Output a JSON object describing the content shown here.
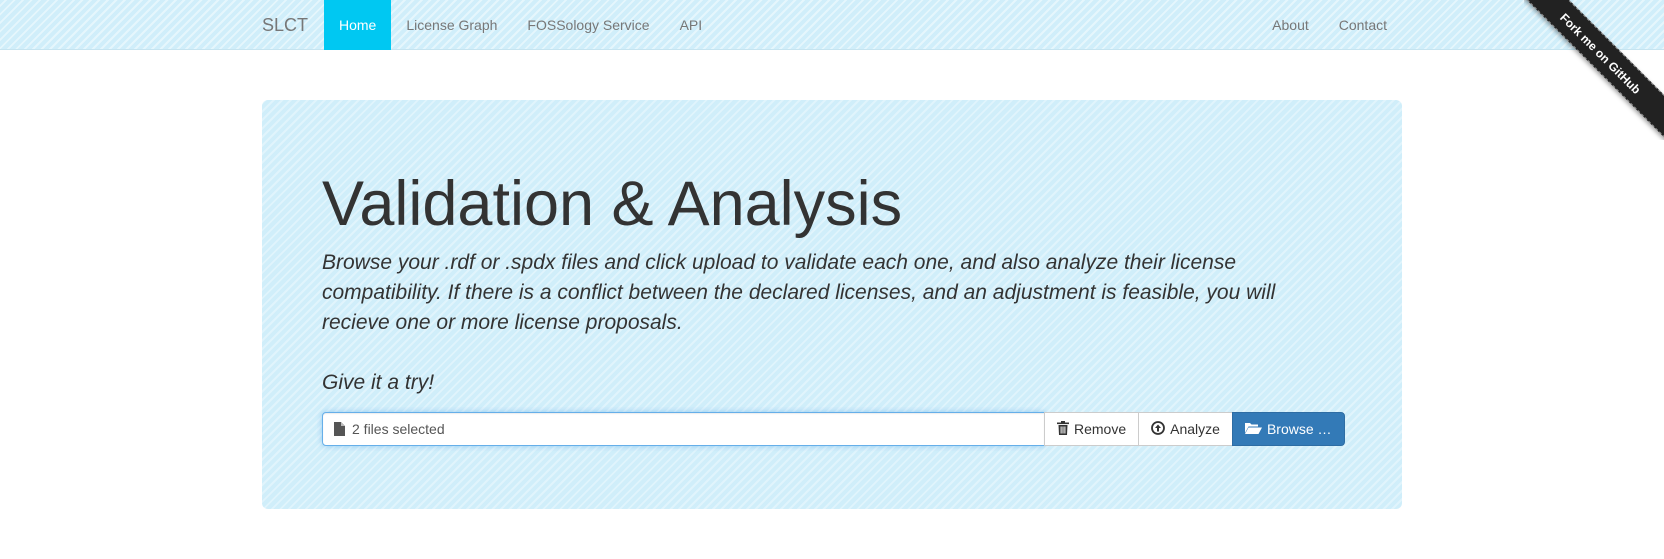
{
  "navbar": {
    "brand": "SLCT",
    "left_items": [
      {
        "label": "Home",
        "active": true
      },
      {
        "label": "License Graph",
        "active": false
      },
      {
        "label": "FOSSology Service",
        "active": false
      },
      {
        "label": "API",
        "active": false
      }
    ],
    "right_items": [
      {
        "label": "About"
      },
      {
        "label": "Contact"
      }
    ]
  },
  "ribbon": {
    "label": "Fork me on GitHub"
  },
  "jumbotron": {
    "title": "Validation & Analysis",
    "lead": "Browse your .rdf or .spdx files and click upload to validate each one, and also analyze their license compatibility. If there is a conflict between the declared licenses, and an adjustment is feasible, you will recieve one or more license proposals.",
    "try_text": "Give it a try!"
  },
  "file_input": {
    "caption": "2 files selected",
    "remove_label": "Remove",
    "analyze_label": "Analyze",
    "browse_label": "Browse …"
  },
  "colors": {
    "accent": "#00c8f2",
    "background_tint": "#d0eefa",
    "primary_button": "#337ab7"
  },
  "icons": {
    "file": "file-icon",
    "remove": "trash-icon",
    "analyze": "circle-arrow-up-icon",
    "browse": "folder-open-icon"
  }
}
